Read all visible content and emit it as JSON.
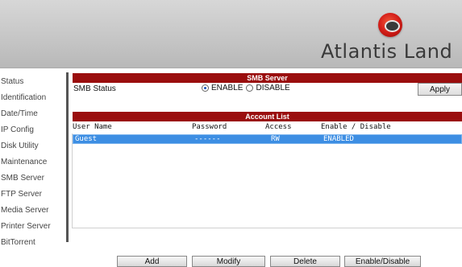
{
  "header": {
    "brand": "Atlantis Land"
  },
  "sidebar": {
    "items": [
      {
        "label": "Status"
      },
      {
        "label": "Identification"
      },
      {
        "label": "Date/Time"
      },
      {
        "label": "IP Config"
      },
      {
        "label": "Disk Utility"
      },
      {
        "label": "Maintenance"
      },
      {
        "label": "SMB Server"
      },
      {
        "label": "FTP Server"
      },
      {
        "label": "Media Server"
      },
      {
        "label": "Printer Server"
      },
      {
        "label": "BitTorrent"
      }
    ]
  },
  "smb": {
    "section_title": "SMB Server",
    "status_label": "SMB Status",
    "enable_label": "ENABLE",
    "disable_label": "DISABLE",
    "selected": "ENABLE",
    "apply_label": "Apply"
  },
  "accounts": {
    "section_title": "Account List",
    "columns": [
      "User Name",
      "Password",
      "Access",
      "Enable / Disable"
    ],
    "rows": [
      {
        "user": "Guest",
        "password": "------",
        "access": "RW",
        "status": "ENABLED",
        "selected": true
      }
    ]
  },
  "actions": {
    "add": "Add",
    "modify": "Modify",
    "delete": "Delete",
    "enable_disable": "Enable/Disable"
  },
  "colors": {
    "section_bar": "#9a0e0e",
    "selected_row": "#3d8ee3",
    "header_bg": "#c8c8c8"
  }
}
